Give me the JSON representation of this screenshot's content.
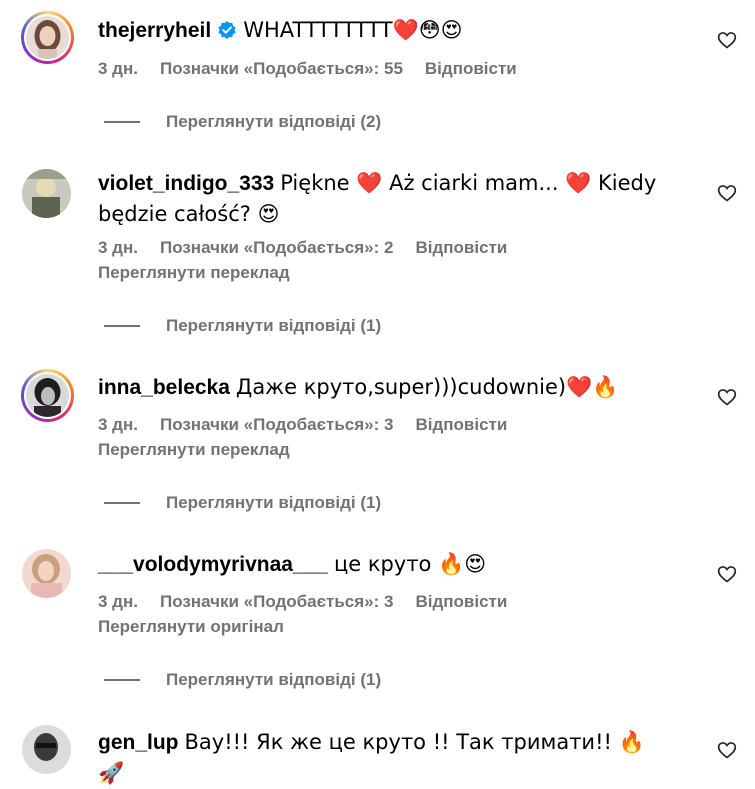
{
  "comments": [
    {
      "username": "thejerryheil",
      "verified": true,
      "text": "WHATTTTTTTT❤️😳😍",
      "time": "3 дн.",
      "likes": "Позначки «Подобається»: 55",
      "reply": "Відповісти",
      "translate": "",
      "view_replies": "Переглянути відповіді (2)"
    },
    {
      "username": "violet_indigo_333",
      "verified": false,
      "text": "Piękne ❤️ Aż ciarki mam... ❤️ Kiedy będzie całość? 😍",
      "time": "3 дн.",
      "likes": "Позначки «Подобається»: 2",
      "reply": "Відповісти",
      "translate": "Переглянути переклад",
      "view_replies": "Переглянути відповіді (1)"
    },
    {
      "username": "inna_belecka",
      "verified": false,
      "text": "Даже круто,super)))cudownie)❤️🔥",
      "time": "3 дн.",
      "likes": "Позначки «Подобається»: 3",
      "reply": "Відповісти",
      "translate": "Переглянути переклад",
      "view_replies": "Переглянути відповіді (1)"
    },
    {
      "username": "___volodymyrivnaa___",
      "verified": false,
      "text": "це круто 🔥😍",
      "time": "3 дн.",
      "likes": "Позначки «Подобається»: 3",
      "reply": "Відповісти",
      "translate": "Переглянути оригінал",
      "view_replies": "Переглянути відповіді (1)"
    },
    {
      "username": "gen_lup",
      "verified": false,
      "text": "Вау!!! Як же це круто !! Так тримати!! 🔥🚀"
    }
  ],
  "colors": {
    "secondary_text": "#737373",
    "verified_blue": "#0095f6",
    "story_ring": "#d62976"
  },
  "icons": {
    "like": "heart-outline-icon",
    "verified": "verified-badge-icon"
  }
}
